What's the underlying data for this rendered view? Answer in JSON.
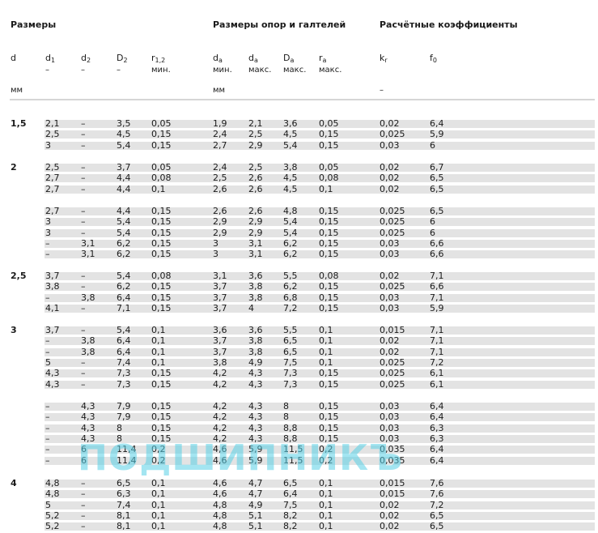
{
  "sections": {
    "dimensions": "Размеры",
    "abutment": "Размеры опор и галтелей",
    "factors": "Расчётные коэффициенты"
  },
  "columns": [
    {
      "key": "d",
      "main": "d",
      "sub": "",
      "line2": ""
    },
    {
      "key": "d1",
      "main": "d",
      "sub": "1",
      "line2": "–"
    },
    {
      "key": "d2",
      "main": "d",
      "sub": "2",
      "line2": "–"
    },
    {
      "key": "D2",
      "main": "D",
      "sub": "2",
      "line2": "–"
    },
    {
      "key": "r12",
      "main": "r",
      "sub": "1,2",
      "line2": "мин."
    },
    {
      "key": "da_min",
      "main": "d",
      "sub": "a",
      "line2": "мин."
    },
    {
      "key": "da_max",
      "main": "d",
      "sub": "a",
      "line2": "макс."
    },
    {
      "key": "Da_max",
      "main": "D",
      "sub": "a",
      "line2": "макс."
    },
    {
      "key": "ra_max",
      "main": "r",
      "sub": "a",
      "line2": "макс."
    },
    {
      "key": "kr",
      "main": "k",
      "sub": "r",
      "line2": ""
    },
    {
      "key": "f0",
      "main": "f",
      "sub": "0",
      "line2": ""
    }
  ],
  "units": {
    "dims": "мм",
    "abutment": "мм",
    "factors": "–"
  },
  "groups": [
    {
      "d": "1,5",
      "rows": [
        [
          "2,1",
          "–",
          "3,5",
          "0,05",
          "1,9",
          "2,1",
          "3,6",
          "0,05",
          "0,02",
          "6,4"
        ],
        [
          "2,5",
          "–",
          "4,5",
          "0,15",
          "2,4",
          "2,5",
          "4,5",
          "0,15",
          "0,025",
          "5,9"
        ],
        [
          "3",
          "–",
          "5,4",
          "0,15",
          "2,7",
          "2,9",
          "5,4",
          "0,15",
          "0,03",
          "6"
        ]
      ]
    },
    {
      "d": "2",
      "rows": [
        [
          "2,5",
          "–",
          "3,7",
          "0,05",
          "2,4",
          "2,5",
          "3,8",
          "0,05",
          "0,02",
          "6,7"
        ],
        [
          "2,7",
          "–",
          "4,4",
          "0,08",
          "2,5",
          "2,6",
          "4,5",
          "0,08",
          "0,02",
          "6,5"
        ],
        [
          "2,7",
          "–",
          "4,4",
          "0,1",
          "2,6",
          "2,6",
          "4,5",
          "0,1",
          "0,02",
          "6,5"
        ]
      ]
    },
    {
      "d": "",
      "rows": [
        [
          "2,7",
          "–",
          "4,4",
          "0,15",
          "2,6",
          "2,6",
          "4,8",
          "0,15",
          "0,025",
          "6,5"
        ],
        [
          "3",
          "–",
          "5,4",
          "0,15",
          "2,9",
          "2,9",
          "5,4",
          "0,15",
          "0,025",
          "6"
        ],
        [
          "3",
          "–",
          "5,4",
          "0,15",
          "2,9",
          "2,9",
          "5,4",
          "0,15",
          "0,025",
          "6"
        ],
        [
          "–",
          "3,1",
          "6,2",
          "0,15",
          "3",
          "3,1",
          "6,2",
          "0,15",
          "0,03",
          "6,6"
        ],
        [
          "–",
          "3,1",
          "6,2",
          "0,15",
          "3",
          "3,1",
          "6,2",
          "0,15",
          "0,03",
          "6,6"
        ]
      ]
    },
    {
      "d": "2,5",
      "rows": [
        [
          "3,7",
          "–",
          "5,4",
          "0,08",
          "3,1",
          "3,6",
          "5,5",
          "0,08",
          "0,02",
          "7,1"
        ],
        [
          "3,8",
          "–",
          "6,2",
          "0,15",
          "3,7",
          "3,8",
          "6,2",
          "0,15",
          "0,025",
          "6,6"
        ],
        [
          "–",
          "3,8",
          "6,4",
          "0,15",
          "3,7",
          "3,8",
          "6,8",
          "0,15",
          "0,03",
          "7,1"
        ],
        [
          "4,1",
          "–",
          "7,1",
          "0,15",
          "3,7",
          "4",
          "7,2",
          "0,15",
          "0,03",
          "5,9"
        ]
      ]
    },
    {
      "d": "3",
      "rows": [
        [
          "3,7",
          "–",
          "5,4",
          "0,1",
          "3,6",
          "3,6",
          "5,5",
          "0,1",
          "0,015",
          "7,1"
        ],
        [
          "–",
          "3,8",
          "6,4",
          "0,1",
          "3,7",
          "3,8",
          "6,5",
          "0,1",
          "0,02",
          "7,1"
        ],
        [
          "–",
          "3,8",
          "6,4",
          "0,1",
          "3,7",
          "3,8",
          "6,5",
          "0,1",
          "0,02",
          "7,1"
        ],
        [
          "5",
          "–",
          "7,4",
          "0,1",
          "3,8",
          "4,9",
          "7,5",
          "0,1",
          "0,025",
          "7,2"
        ],
        [
          "4,3",
          "–",
          "7,3",
          "0,15",
          "4,2",
          "4,3",
          "7,3",
          "0,15",
          "0,025",
          "6,1"
        ],
        [
          "4,3",
          "–",
          "7,3",
          "0,15",
          "4,2",
          "4,3",
          "7,3",
          "0,15",
          "0,025",
          "6,1"
        ]
      ]
    },
    {
      "d": "",
      "rows": [
        [
          "–",
          "4,3",
          "7,9",
          "0,15",
          "4,2",
          "4,3",
          "8",
          "0,15",
          "0,03",
          "6,4"
        ],
        [
          "–",
          "4,3",
          "7,9",
          "0,15",
          "4,2",
          "4,3",
          "8",
          "0,15",
          "0,03",
          "6,4"
        ],
        [
          "–",
          "4,3",
          "8",
          "0,15",
          "4,2",
          "4,3",
          "8,8",
          "0,15",
          "0,03",
          "6,3"
        ],
        [
          "–",
          "4,3",
          "8",
          "0,15",
          "4,2",
          "4,3",
          "8,8",
          "0,15",
          "0,03",
          "6,3"
        ],
        [
          "–",
          "6",
          "11,4",
          "0,2",
          "4,6",
          "5,9",
          "11,5",
          "0,2",
          "0,035",
          "6,4"
        ],
        [
          "–",
          "6",
          "11,4",
          "0,2",
          "4,6",
          "5,9",
          "11,5",
          "0,2",
          "0,035",
          "6,4"
        ]
      ]
    },
    {
      "d": "4",
      "rows": [
        [
          "4,8",
          "–",
          "6,5",
          "0,1",
          "4,6",
          "4,7",
          "6,5",
          "0,1",
          "0,015",
          "7,6"
        ],
        [
          "4,8",
          "–",
          "6,3",
          "0,1",
          "4,6",
          "4,7",
          "6,4",
          "0,1",
          "0,015",
          "7,6"
        ],
        [
          "5",
          "–",
          "7,4",
          "0,1",
          "4,8",
          "4,9",
          "7,5",
          "0,1",
          "0,02",
          "7,2"
        ],
        [
          "5,2",
          "–",
          "8,1",
          "0,1",
          "4,8",
          "5,1",
          "8,2",
          "0,1",
          "0,02",
          "6,5"
        ],
        [
          "5,2",
          "–",
          "8,1",
          "0,1",
          "4,8",
          "5,1",
          "8,2",
          "0,1",
          "0,02",
          "6,5"
        ]
      ]
    }
  ],
  "watermark": "ПОДШИПНИКЪ"
}
